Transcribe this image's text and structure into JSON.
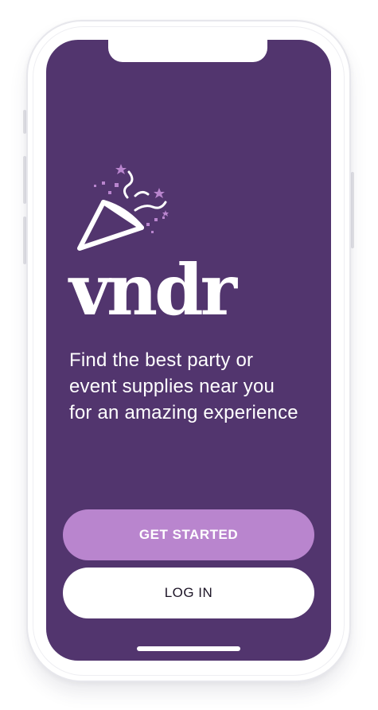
{
  "app": {
    "brand_name": "vndr",
    "tagline": "Find the best party or event supplies near you for an amazing experience"
  },
  "actions": {
    "get_started_label": "GET STARTED",
    "login_label": "LOG IN"
  },
  "icons": {
    "hero": "party-popper-icon"
  },
  "colors": {
    "screen_background": "#52356e",
    "accent": "#b985ce",
    "text": "#ffffff",
    "secondary_button_bg": "#ffffff",
    "secondary_button_text": "#1c1426"
  }
}
